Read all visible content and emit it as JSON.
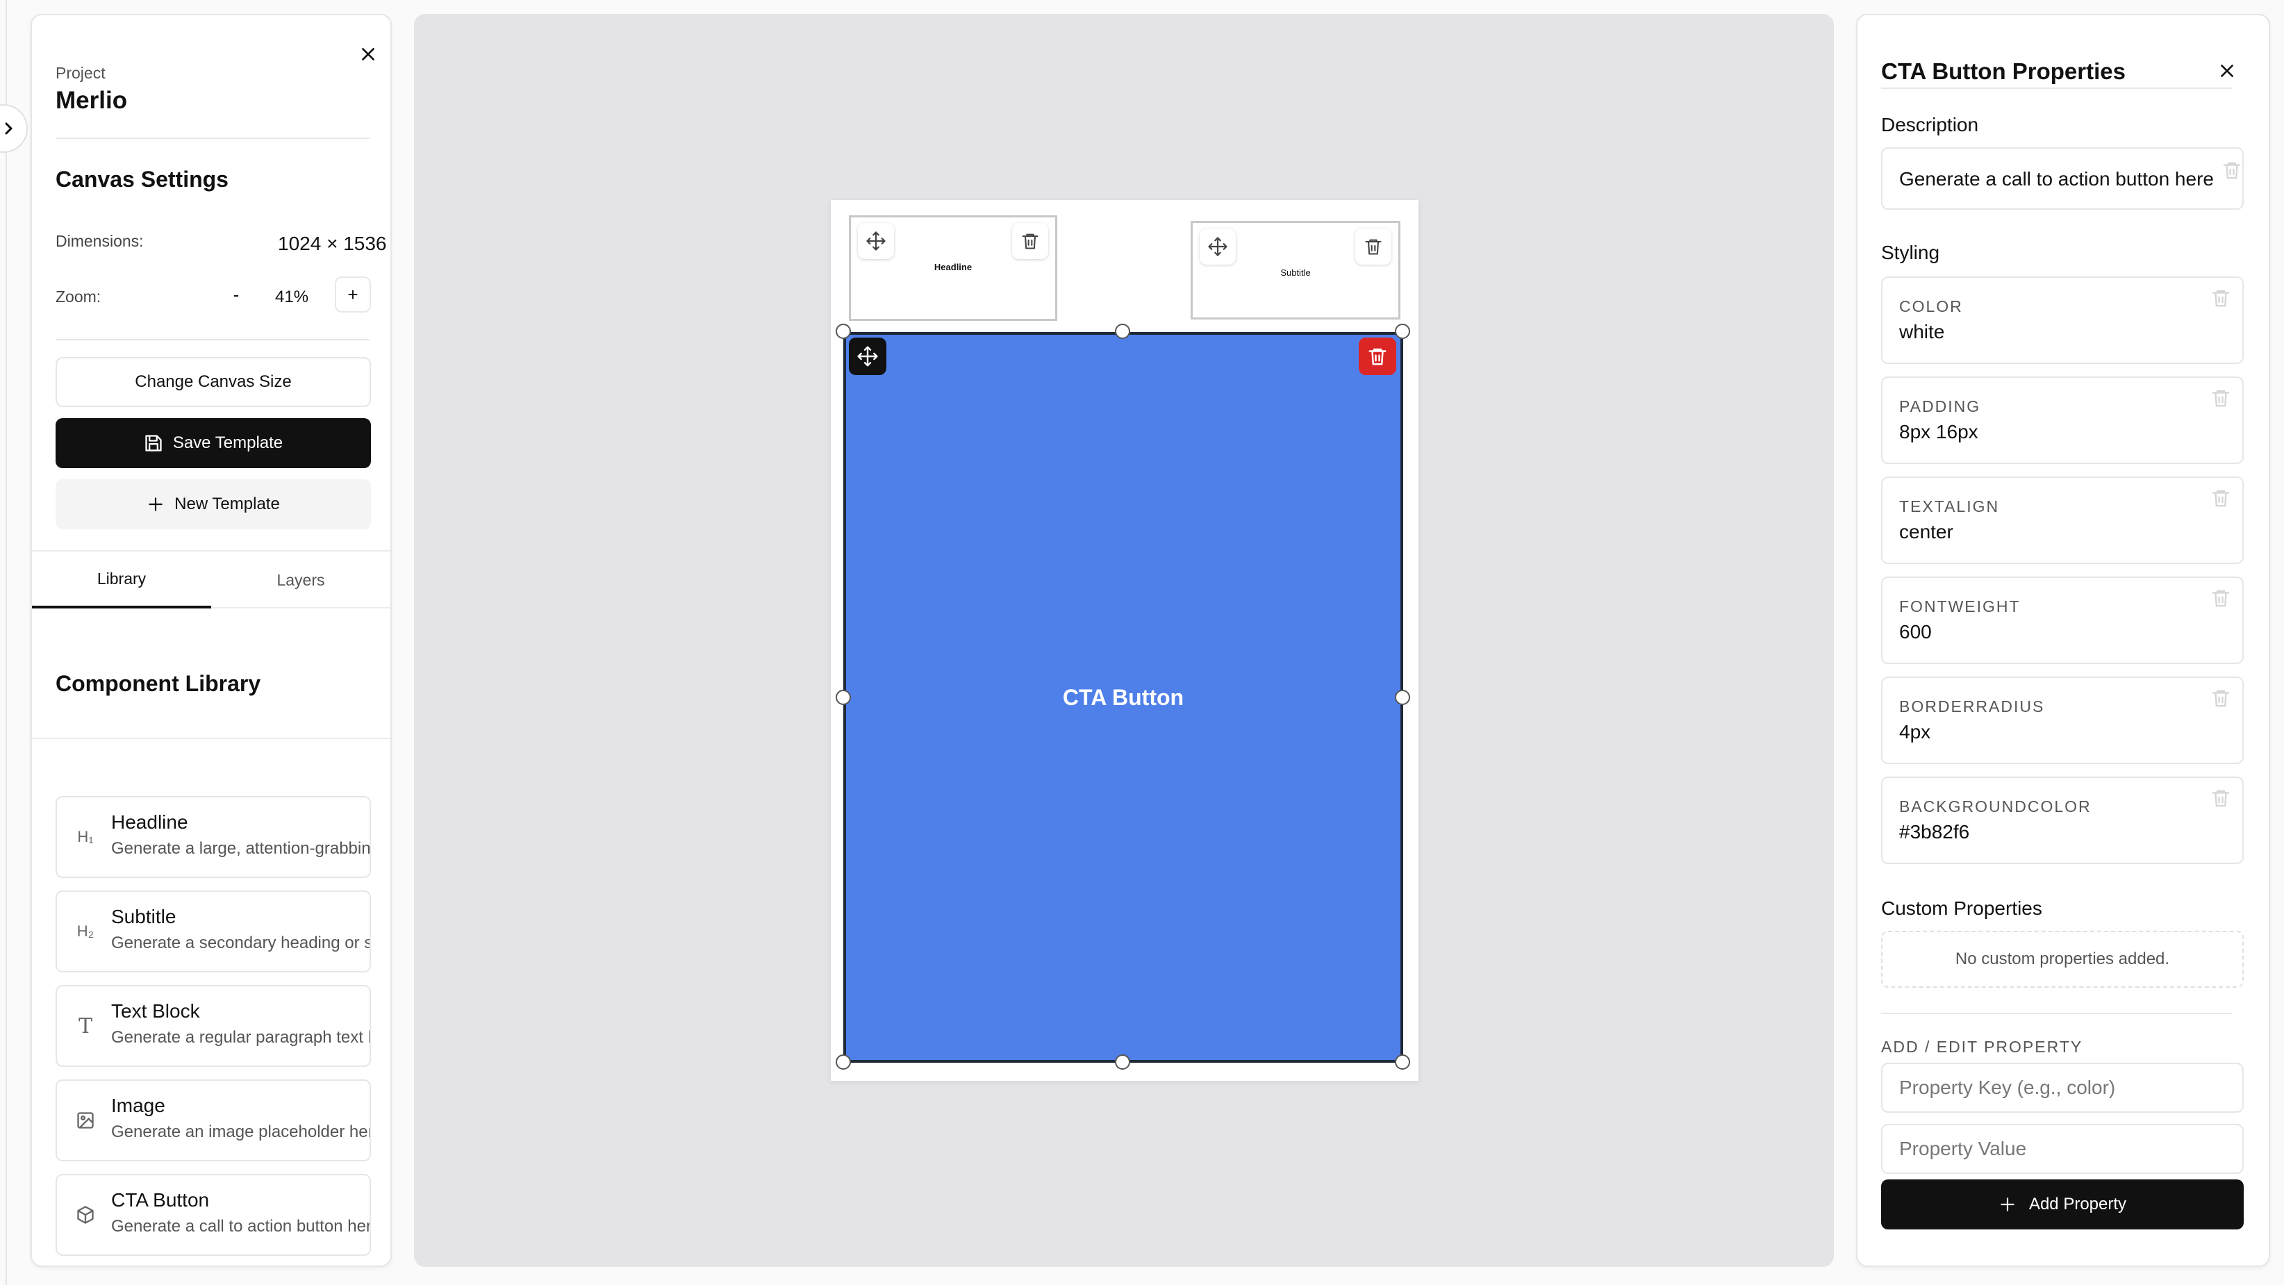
{
  "project": {
    "label": "Project",
    "name": "Merlio"
  },
  "canvas_settings": {
    "title": "Canvas Settings",
    "dimensions_label": "Dimensions:",
    "dimensions_value": "1024 × 1536",
    "zoom_label": "Zoom:",
    "zoom_minus": "-",
    "zoom_value": "41%",
    "zoom_plus": "+"
  },
  "buttons": {
    "change_size": "Change Canvas Size",
    "save_template": "Save Template",
    "new_template": "New Template"
  },
  "tabs": {
    "library": "Library",
    "layers": "Layers"
  },
  "library": {
    "title": "Component Library",
    "items": [
      {
        "name": "Headline",
        "desc": "Generate a large, attention-grabbing headline",
        "icon": "heading-1-icon",
        "glyph": "H₁"
      },
      {
        "name": "Subtitle",
        "desc": "Generate a secondary heading or subtitle",
        "icon": "heading-2-icon",
        "glyph": "H₂"
      },
      {
        "name": "Text Block",
        "desc": "Generate a regular paragraph text block",
        "icon": "type-icon",
        "glyph": "T"
      },
      {
        "name": "Image",
        "desc": "Generate an image placeholder here",
        "icon": "image-icon",
        "glyph": ""
      },
      {
        "name": "CTA Button",
        "desc": "Generate a call to action button here",
        "icon": "box-icon",
        "glyph": ""
      }
    ]
  },
  "canvas": {
    "headline_text": "Headline",
    "subtitle_text": "Subtitle",
    "cta_text": "CTA Button"
  },
  "properties": {
    "title": "CTA Button Properties",
    "description_label": "Description",
    "description_value": "Generate a call to action button here",
    "styling_label": "Styling",
    "styles": [
      {
        "key": "COLOR",
        "value": "white"
      },
      {
        "key": "PADDING",
        "value": "8px 16px"
      },
      {
        "key": "TEXTALIGN",
        "value": "center"
      },
      {
        "key": "FONTWEIGHT",
        "value": "600"
      },
      {
        "key": "BORDERRADIUS",
        "value": "4px"
      },
      {
        "key": "BACKGROUNDCOLOR",
        "value": "#3b82f6"
      }
    ],
    "custom_label": "Custom Properties",
    "custom_empty": "No custom properties added.",
    "add_edit_label": "ADD / EDIT PROPERTY",
    "key_placeholder": "Property Key (e.g., color)",
    "value_placeholder": "Property Value",
    "add_button": "Add Property"
  },
  "colors": {
    "accent_dark": "#111111",
    "cta_blue": "#4f80ea",
    "danger_red": "#dc2626",
    "canvas_bg": "#e4e4e7"
  }
}
